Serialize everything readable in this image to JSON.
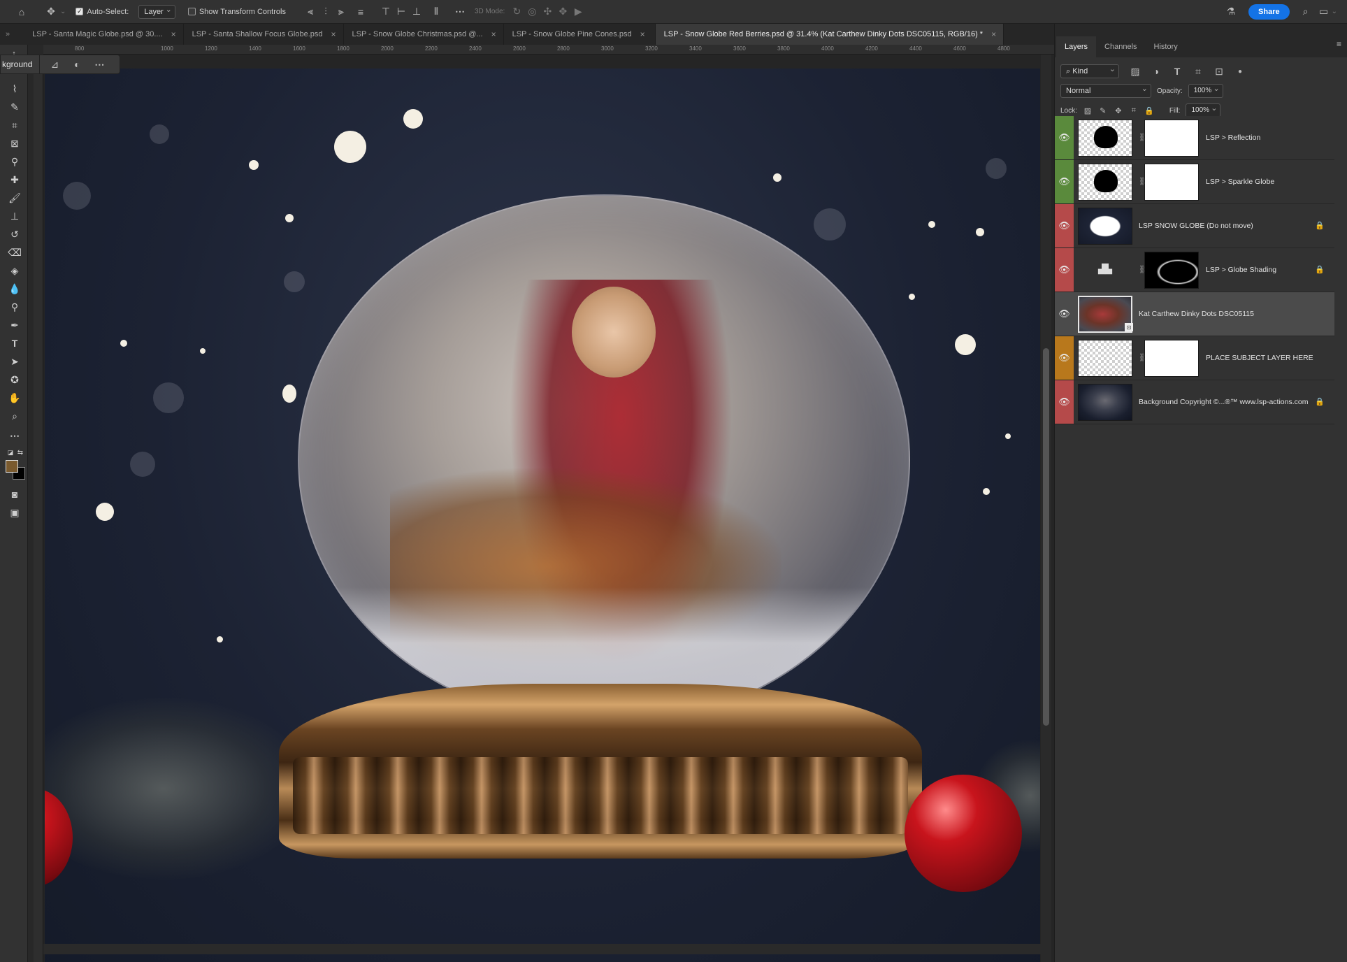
{
  "options_bar": {
    "auto_select_label": "Auto-Select:",
    "auto_select_value": "Layer",
    "show_transform_label": "Show Transform Controls",
    "mode_3d_label": "3D Mode:",
    "share_label": "Share"
  },
  "tabs": [
    {
      "title": "LSP - Santa Magic Globe.psd @ 30....",
      "close": "×",
      "active": false
    },
    {
      "title": "LSP - Santa Shallow Focus Globe.psd",
      "close": "×",
      "active": false
    },
    {
      "title": "LSP - Snow Globe Christmas.psd @...",
      "close": "×",
      "active": false
    },
    {
      "title": "LSP - Snow Globe Pine Cones.psd",
      "close": "×",
      "active": false
    },
    {
      "title": "LSP - Snow Globe Red Berries.psd @ 31.4% (Kat Carthew Dinky Dots DSC05115, RGB/16) *",
      "close": "×",
      "active": true
    }
  ],
  "ruler_labels": [
    "800",
    "1000",
    "1200",
    "1400",
    "1600",
    "1800",
    "2000",
    "2200",
    "2400",
    "2600",
    "2800",
    "3000",
    "3200",
    "3400",
    "3600",
    "3800",
    "4000",
    "4200",
    "4400",
    "4600",
    "4800"
  ],
  "context_bar": {
    "label": "kground"
  },
  "panel": {
    "tabs": [
      "Layers",
      "Channels",
      "History"
    ],
    "active_tab": "Layers",
    "filter_kind": "Kind",
    "blend_mode": "Normal",
    "opacity_label": "Opacity:",
    "opacity_value": "100%",
    "lock_label": "Lock:",
    "fill_label": "Fill:",
    "fill_value": "100%",
    "layers": [
      {
        "name": "LSP > Reflection",
        "tag_color": "#5a8a3c",
        "locked": false,
        "selected": false,
        "has_mask": true
      },
      {
        "name": "LSP > Sparkle Globe",
        "tag_color": "#5a8a3c",
        "locked": false,
        "selected": false,
        "has_mask": true
      },
      {
        "name": "LSP SNOW GLOBE (Do not move)",
        "tag_color": "#b54a4a",
        "locked": true,
        "selected": false,
        "has_mask": false
      },
      {
        "name": "LSP > Globe Shading",
        "tag_color": "#b54a4a",
        "locked": true,
        "selected": false,
        "has_mask": true
      },
      {
        "name": "Kat Carthew Dinky Dots DSC05115",
        "tag_color": "",
        "locked": false,
        "selected": true,
        "has_mask": false
      },
      {
        "name": "PLACE SUBJECT LAYER HERE",
        "tag_color": "#b8781c",
        "locked": false,
        "selected": false,
        "has_mask": true
      },
      {
        "name": "Background Copyright ©...®™ www.lsp-actions.com",
        "tag_color": "#b54a4a",
        "locked": true,
        "selected": false,
        "has_mask": false
      }
    ]
  },
  "icons": [
    "home-icon",
    "move-icon",
    "search-icon",
    "workspace-icon",
    "beaker-icon",
    "eye-icon",
    "lock-icon",
    "chain-icon"
  ],
  "colors": {
    "accent": "#1473e6",
    "foreground_swatch": "#7a5a2e",
    "background_swatch": "#000000"
  }
}
